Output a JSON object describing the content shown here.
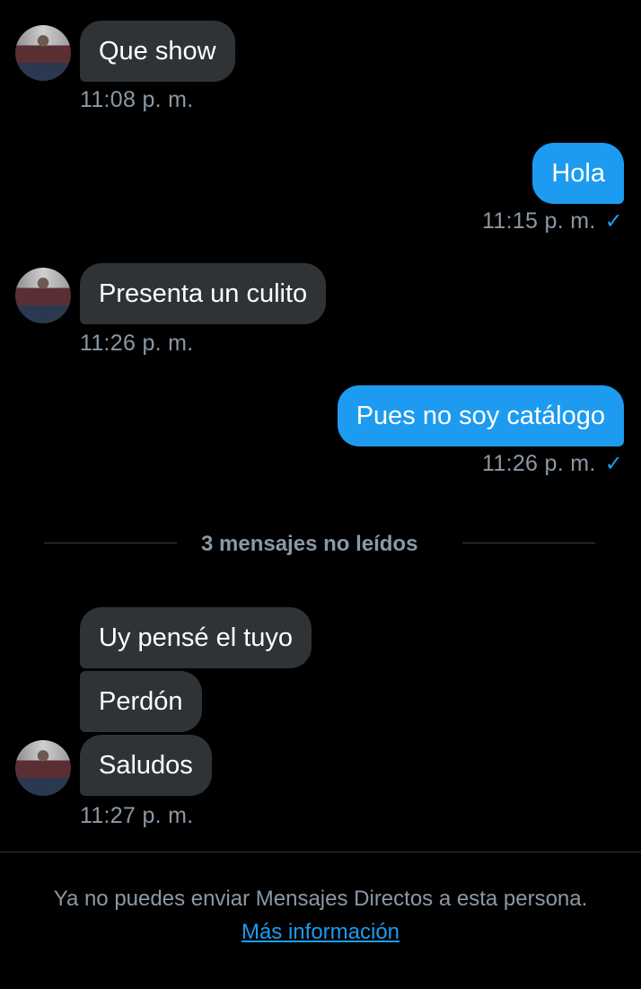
{
  "messages": [
    {
      "text": "Que show",
      "time": "11:08 p. m."
    },
    {
      "text": "Hola",
      "time": "11:15 p. m."
    },
    {
      "text": "Presenta un culito",
      "time": "11:26 p. m."
    },
    {
      "text": "Pues no soy catálogo",
      "time": "11:26 p. m."
    },
    {
      "text": "Uy pensé el tuyo"
    },
    {
      "text": "Perdón"
    },
    {
      "text": "Saludos",
      "time": "11:27 p. m."
    }
  ],
  "read_receipt_icon": "check-icon",
  "unread_divider": "3 mensajes no leídos",
  "footer": {
    "notice": "Ya no puedes enviar Mensajes Directos a esta persona.",
    "link": "Más información"
  },
  "colors": {
    "background": "#000000",
    "incoming_bubble": "#2f3336",
    "outgoing_bubble": "#1d9bf0",
    "timestamp": "#8b98a5"
  }
}
